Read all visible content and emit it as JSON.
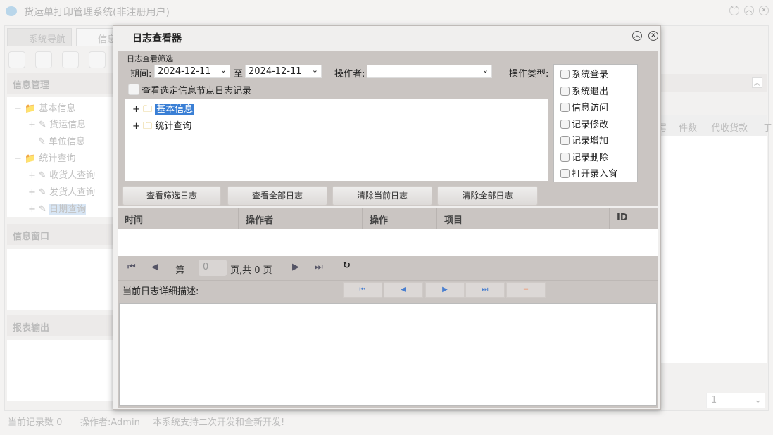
{
  "app": {
    "title": "货运单打印管理系统(非注册用户)",
    "tabs": [
      "系统导航",
      "信息"
    ],
    "left": {
      "panel1": "信息管理",
      "tree": [
        {
          "label": "基本信息",
          "children": [
            "货运信息",
            "单位信息"
          ]
        },
        {
          "label": "统计查询",
          "children": [
            "收货人查询",
            "发货人查询",
            "日期查询"
          ]
        }
      ],
      "panel2": "信息窗口",
      "panel3": "报表输出"
    },
    "grid_headers": [
      "号",
      "件数",
      "代收货款",
      "于"
    ],
    "page_select": "1",
    "status": {
      "records": "当前记录数 0",
      "operator": "操作者:Admin",
      "message": "本系统支持二次开发和全新开发!"
    }
  },
  "dialog": {
    "title": "日志查看器",
    "filter": {
      "group": "日志查看筛选",
      "period_label": "期间:",
      "date_from": "2024-12-11",
      "to_label": "至",
      "date_to": "2024-12-11",
      "operator_label": "操作者:",
      "operator_value": "",
      "optype_label": "操作类型:",
      "node_checkbox": "查看选定信息节点日志记录",
      "node_checked": false,
      "tree": [
        "基本信息",
        "统计查询"
      ],
      "optypes": [
        {
          "label": "系统登录",
          "checked": false
        },
        {
          "label": "系统退出",
          "checked": false
        },
        {
          "label": "信息访问",
          "checked": false
        },
        {
          "label": "记录修改",
          "checked": false
        },
        {
          "label": "记录增加",
          "checked": false
        },
        {
          "label": "记录删除",
          "checked": false
        },
        {
          "label": "打开录入窗",
          "checked": false
        }
      ]
    },
    "buttons": [
      "查看筛选日志",
      "查看全部日志",
      "清除当前日志",
      "清除全部日志"
    ],
    "columns": [
      "时间",
      "操作者",
      "操作",
      "项目",
      "ID"
    ],
    "pager": {
      "page_prefix": "第",
      "page_value": "0",
      "page_suffix": "页,共 0 页"
    },
    "detail_label": "当前日志详细描述:"
  }
}
